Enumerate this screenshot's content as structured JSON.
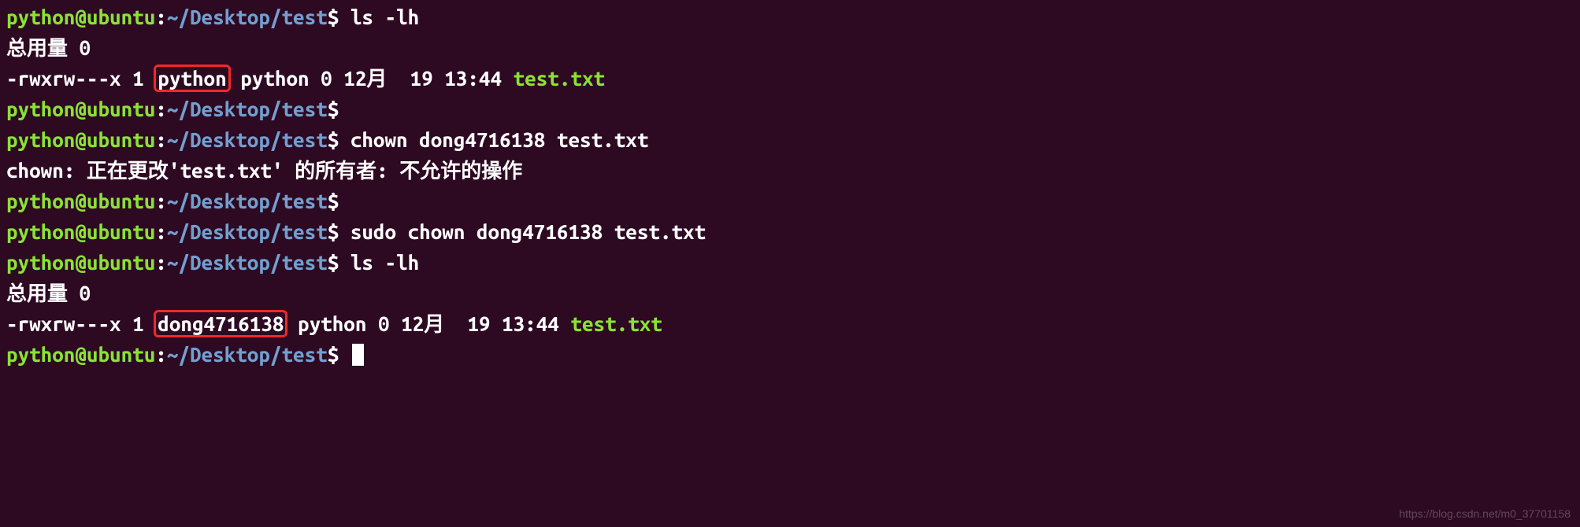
{
  "prompt": {
    "user": "python@ubuntu",
    "sep": ":",
    "path": "~/Desktop/test",
    "sym": "$"
  },
  "lines": {
    "l1_cmd": "ls -lh",
    "l2_total": "总用量 0",
    "l3": {
      "perms": "-rwxrw---x",
      "links": "1",
      "owner": "python",
      "group": "python",
      "size": "0",
      "date": "12月  19 13:44",
      "file": "test.txt"
    },
    "l4_cmd": "",
    "l5_cmd": "chown dong4716138 test.txt",
    "l6_out": "chown: 正在更改'test.txt' 的所有者: 不允许的操作",
    "l7_cmd": "",
    "l8_cmd": "sudo chown dong4716138 test.txt",
    "l9_cmd": "ls -lh",
    "l10_total": "总用量 0",
    "l11": {
      "perms": "-rwxrw---x",
      "links": "1",
      "owner": "dong4716138",
      "group": "python",
      "size": "0",
      "date": "12月  19 13:44",
      "file": "test.txt"
    },
    "l12_cmd": ""
  },
  "watermark": "https://blog.csdn.net/m0_37701158"
}
